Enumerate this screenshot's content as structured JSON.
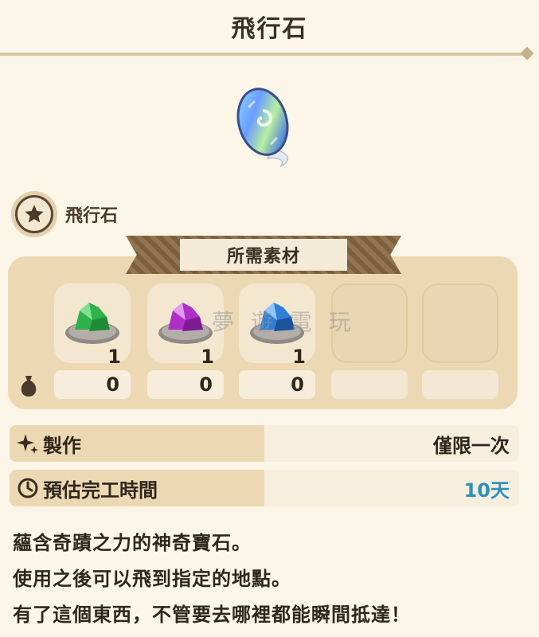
{
  "header": {
    "title": "飛行石"
  },
  "item": {
    "name": "飛行石",
    "image_icon": "flying-stone-icon"
  },
  "materials": {
    "header": "所需素材",
    "slots": [
      {
        "icon": "green-ore-icon",
        "required": "1",
        "owned": "0"
      },
      {
        "icon": "purple-ore-icon",
        "required": "1",
        "owned": "0"
      },
      {
        "icon": "blue-ore-icon",
        "required": "1",
        "owned": "0"
      },
      {
        "icon": "",
        "required": "",
        "owned": ""
      },
      {
        "icon": "",
        "required": "",
        "owned": ""
      }
    ]
  },
  "watermark": "夢 遊 電 玩",
  "craft": {
    "label": "製作",
    "value": "僅限一次"
  },
  "time": {
    "label": "預估完工時間",
    "value": "10天"
  },
  "description": [
    "蘊含奇蹟之力的神奇寶石。",
    "使用之後可以飛到指定的地點。",
    "有了這個東西，不管要去哪裡都能瞬間抵達！"
  ],
  "colors": {
    "accent_blue": "#2d8fbd",
    "panel": "#ecd9b4",
    "background": "#fbf6e8"
  }
}
